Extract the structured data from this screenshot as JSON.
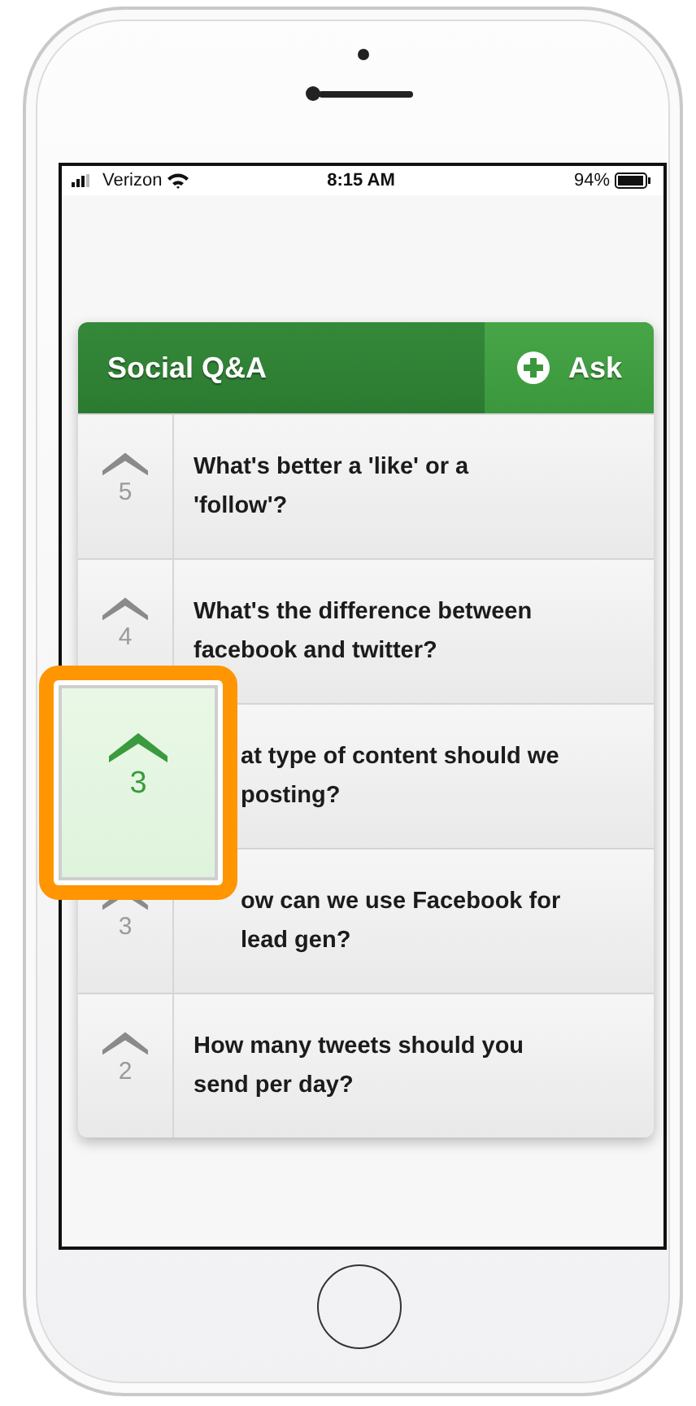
{
  "status_bar": {
    "carrier": "Verizon",
    "time": "8:15 AM",
    "battery": "94%"
  },
  "header": {
    "title": "Social Q&A",
    "ask_button": "Ask"
  },
  "questions": [
    {
      "votes": "5",
      "lines": [
        "What's better a 'like' or a",
        "'follow'?"
      ],
      "covered": false
    },
    {
      "votes": "4",
      "lines": [
        "What's the difference between",
        "facebook and twitter?"
      ],
      "covered": false
    },
    {
      "lines": [
        "at type of content should we",
        "posting?"
      ],
      "covered": true
    },
    {
      "votes": "3",
      "lines": [
        "ow can we use Facebook for",
        "lead gen?"
      ],
      "covered": true
    },
    {
      "votes": "2",
      "lines": [
        "How many tweets should you",
        "send per day?"
      ],
      "covered": false
    }
  ],
  "callout": {
    "votes": "3",
    "selected": true
  }
}
